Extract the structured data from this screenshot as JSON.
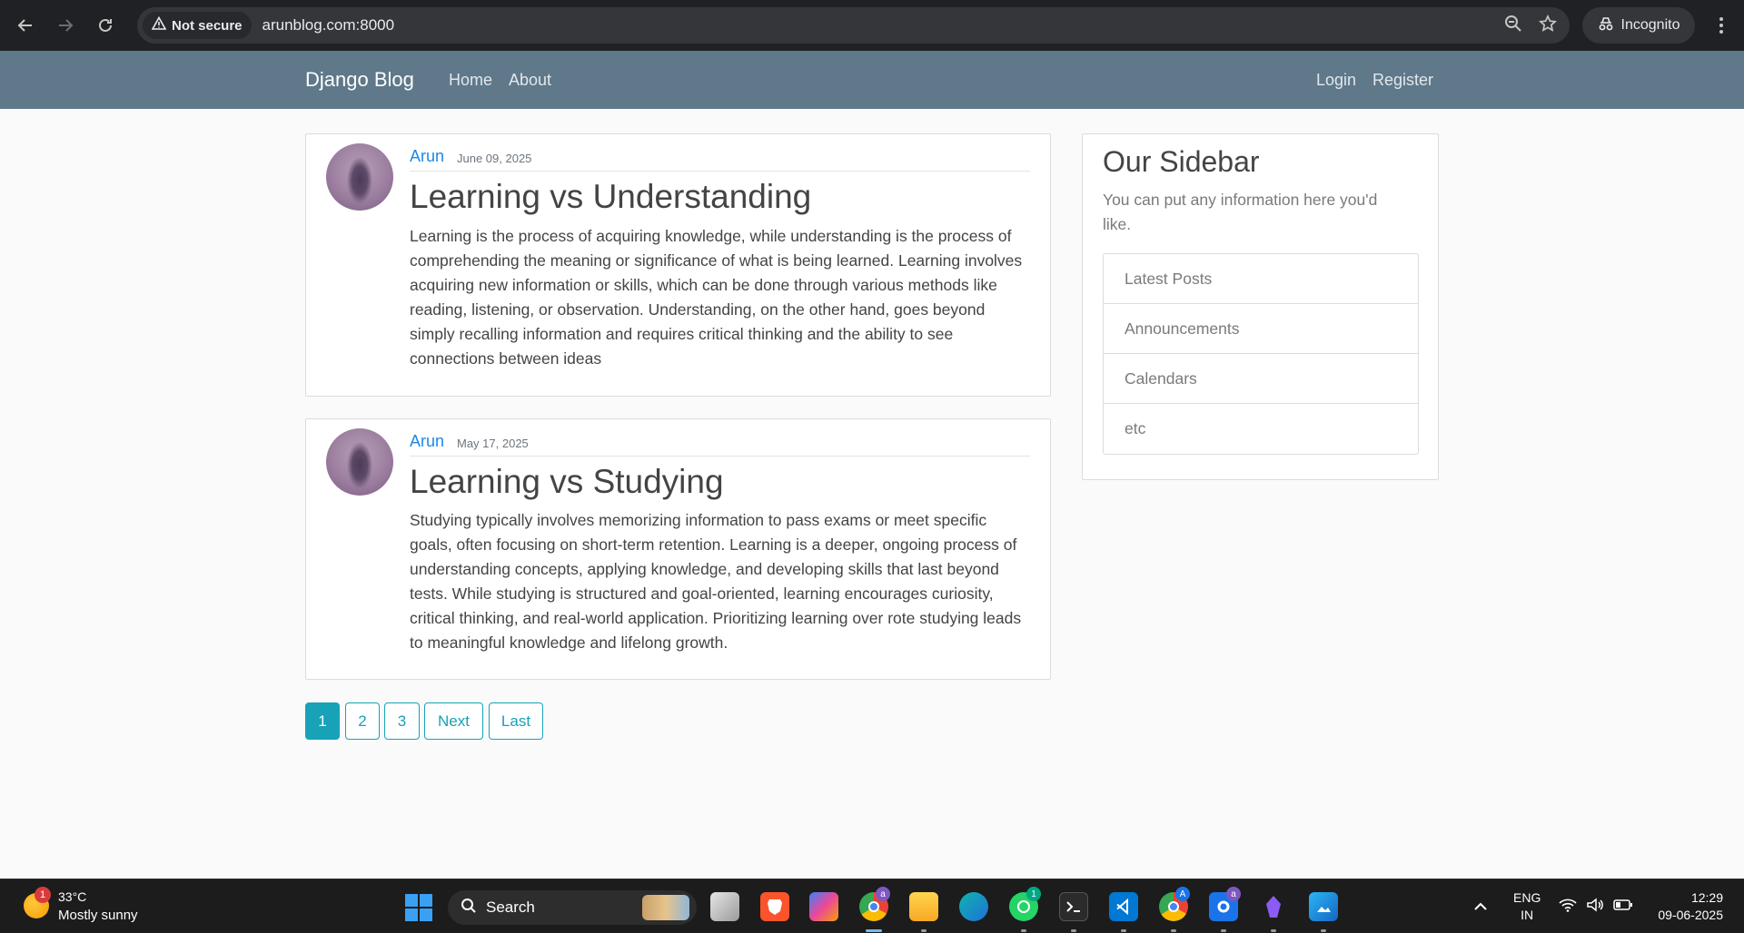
{
  "browser": {
    "security_label": "Not secure",
    "url": "arunblog.com:8000",
    "profile_label": "Incognito"
  },
  "site": {
    "brand": "Django Blog",
    "nav_left": [
      "Home",
      "About"
    ],
    "nav_right": [
      "Login",
      "Register"
    ]
  },
  "posts": [
    {
      "author": "Arun",
      "date": "June 09, 2025",
      "title": "Learning vs Understanding",
      "content": "Learning is the process of acquiring knowledge, while understanding is the process of comprehending the meaning or significance of what is being learned. Learning involves acquiring new information or skills, which can be done through various methods like reading, listening, or observation. Understanding, on the other hand, goes beyond simply recalling information and requires critical thinking and the ability to see connections between ideas"
    },
    {
      "author": "Arun",
      "date": "May 17, 2025",
      "title": "Learning vs Studying",
      "content": "Studying typically involves memorizing information to pass exams or meet specific goals, often focusing on short-term retention. Learning is a deeper, ongoing process of understanding concepts, applying knowledge, and developing skills that last beyond tests. While studying is structured and goal-oriented, learning encourages curiosity, critical thinking, and real-world application. Prioritizing learning over rote studying leads to meaningful knowledge and lifelong growth."
    }
  ],
  "pagination": [
    "1",
    "2",
    "3",
    "Next",
    "Last"
  ],
  "sidebar": {
    "title": "Our Sidebar",
    "description": "You can put any information here you'd like.",
    "items": [
      "Latest Posts",
      "Announcements",
      "Calendars",
      "etc"
    ]
  },
  "taskbar": {
    "weather_badge": "1",
    "temperature": "33°C",
    "condition": "Mostly sunny",
    "search_label": "Search",
    "whatsapp_badge": "1",
    "chrome_badge": "a",
    "chrome2_badge": "A",
    "app_badge": "a",
    "lang_top": "ENG",
    "lang_bottom": "IN",
    "time": "12:29",
    "date": "09-06-2025"
  },
  "colors": {
    "navbar": "#5f788a",
    "accent": "#17a2b8",
    "author_link": "#1e88e5"
  }
}
